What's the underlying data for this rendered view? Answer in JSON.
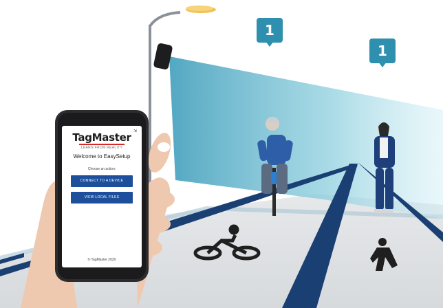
{
  "scene": {
    "counters": [
      {
        "label": "1"
      },
      {
        "label": "1"
      }
    ],
    "colors": {
      "sky": "#ffffff",
      "beam": "#7fc4d6",
      "badge": "#2f8fae",
      "road": "#dfe1e4",
      "lane_line": "#1a3f73",
      "phone_button": "#1d4f9c",
      "brand_underline": "#d62a2a"
    },
    "icons": [
      "sensor-icon",
      "street-lamp-icon",
      "bicycle-icon",
      "pedestrian-icon"
    ]
  },
  "app": {
    "brand": "TagMaster",
    "tagline": "LEARN FROM REALITY",
    "corner_glyph": "⇲",
    "welcome": "Welcome to EasySetup",
    "prompt": "Choose an action:",
    "buttons": [
      {
        "label": "CONNECT TO A DEVICE"
      },
      {
        "label": "VIEW LOCAL FILES"
      }
    ],
    "footer": "© TagMaster 2020"
  }
}
